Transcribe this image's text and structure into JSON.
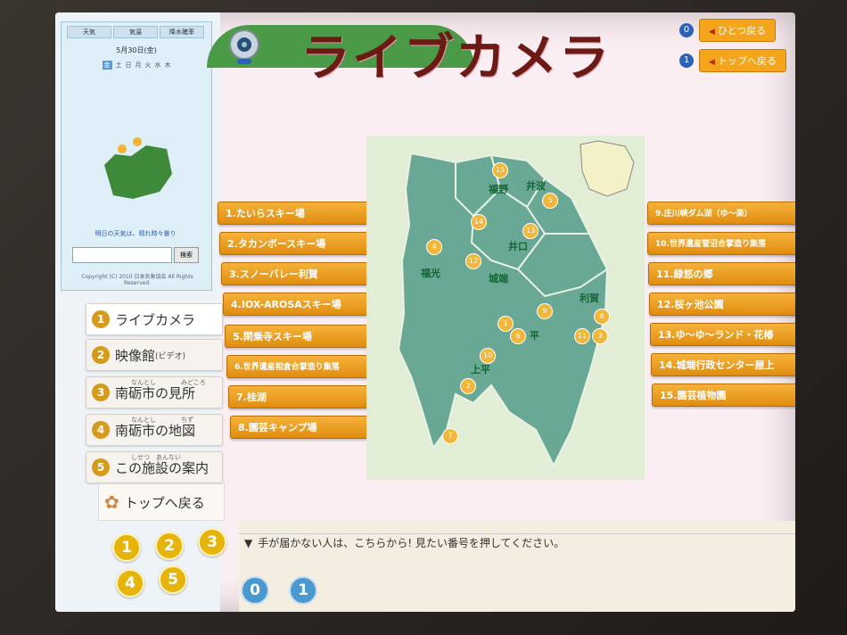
{
  "header": {
    "title": "ライブカメラ",
    "nav": [
      {
        "num": "0",
        "label": "ひとつ戻る"
      },
      {
        "num": "1",
        "label": "トップへ戻る"
      }
    ]
  },
  "widget": {
    "tabs": [
      "天気",
      "気温",
      "降水確率"
    ],
    "date": "5月30日(金)",
    "days": [
      "金",
      "土",
      "日",
      "月",
      "火",
      "水",
      "木"
    ],
    "weather_link": "明日の天気は、晴れ時々曇り",
    "search_button": "検索",
    "copyright": "Copyright (C) 2010 日本気象協会 All Rights Reserved."
  },
  "side_menu": [
    {
      "num": "1",
      "label": "ライブカメラ",
      "ruby": "",
      "sub": ""
    },
    {
      "num": "2",
      "label": "映像館",
      "ruby": "",
      "sub": "(ビデオ)"
    },
    {
      "num": "3",
      "label": "南砺市の見所",
      "ruby": "なんとし　　　　みどころ",
      "sub": ""
    },
    {
      "num": "4",
      "label": "南砺市の地図",
      "ruby": "なんとし　　　　ちず",
      "sub": ""
    },
    {
      "num": "5",
      "label": "この施設の案内",
      "ruby": "しせつ　あんない",
      "sub": ""
    }
  ],
  "home_button": {
    "label": "トップへ戻る",
    "ruby": "もど"
  },
  "number_pad": [
    "1",
    "2",
    "3",
    "4",
    "5"
  ],
  "cameras_left": [
    "1.たいらスキー場",
    "2.タカンボースキー場",
    "3.スノーバレー利賀",
    "4.IOX-AROSAスキー場",
    "5.閑乗寺スキー場",
    "6.世界遺産相倉合掌造り集落",
    "7.桂湖",
    "8.園芸キャンプ場"
  ],
  "cameras_right": [
    "9.庄川峡ダム湖（ゆ～楽）",
    "10.世界遺産菅沼合掌造り集落",
    "11.緑悠の郷",
    "12.桜ヶ池公園",
    "13.ゆ～ゆ～ランド・花椿",
    "14.城端行政センター屋上",
    "15.園芸植物園"
  ],
  "map": {
    "regions": [
      "福野",
      "井波",
      "井口",
      "福光",
      "城端",
      "利賀",
      "平",
      "上平"
    ],
    "markers": [
      "15",
      "5",
      "14",
      "13",
      "4",
      "12",
      "9",
      "8",
      "1",
      "6",
      "11",
      "3",
      "10",
      "2",
      "7"
    ]
  },
  "bottom": {
    "instruction": "手が届かない人は、こちらから! 見たい番号を押してください。",
    "buttons": [
      "0",
      "1"
    ]
  },
  "colors": {
    "title": "#6c1a14",
    "camera_button": "#f0a020",
    "map_region": "#6aa896",
    "accent_blue": "#2b61b7"
  }
}
